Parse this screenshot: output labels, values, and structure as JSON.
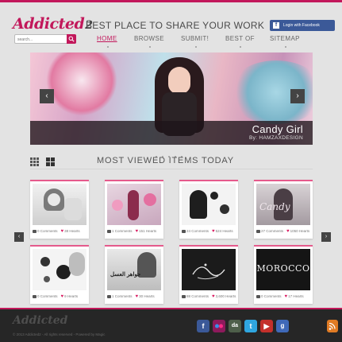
{
  "header": {
    "logo_text": "Addicted",
    "logo_number": "2",
    "tagline": "BEST PLACE TO SHARE YOUR WORK",
    "facebook_login": "Login with Facebook",
    "search_placeholder": "search..."
  },
  "nav": {
    "items": [
      {
        "label": "HOME",
        "active": true
      },
      {
        "label": "BROWSE"
      },
      {
        "label": "SUBMIT!"
      },
      {
        "label": "BEST OF"
      },
      {
        "label": "SITEMAP"
      }
    ]
  },
  "banner": {
    "title": "Candy Girl",
    "author": "By: HAMZAXDESIGN",
    "prev_icon": "chevron-left-icon",
    "next_icon": "chevron-right-icon"
  },
  "section": {
    "title": "MOST VIEWED ITEMS TODAY",
    "view_icons": [
      "list-grid-icon",
      "large-grid-icon"
    ]
  },
  "items": [
    {
      "comments": "0 Comments",
      "hearts": "38 Hearts"
    },
    {
      "comments": "1 Comments",
      "hearts": "151 Hearts"
    },
    {
      "comments": "24 Comments",
      "hearts": "524 Hearts"
    },
    {
      "comments": "27 Comments",
      "hearts": "1050 Hearts"
    },
    {
      "comments": "0 Comments",
      "hearts": "9 Hearts"
    },
    {
      "comments": "1 Comments",
      "hearts": "30 Hearts"
    },
    {
      "comments": "88 Comments",
      "hearts": "3,600 Hearts"
    },
    {
      "comments": "0 Comments",
      "hearts": "17 Hearts"
    }
  ],
  "item_thumb_text": {
    "card4": "Candy",
    "card6": "جواهر العسل",
    "card8": "MOROCCO"
  },
  "footer": {
    "logo_text": "Addicted",
    "copyright": "© 2013 Addicted2 - All rights reserved - Powered by Magic",
    "social": [
      "facebook-icon",
      "flickr-icon",
      "deviantart-icon",
      "twitter-icon",
      "youtube-icon",
      "google-plus-icon",
      "rss-icon"
    ]
  },
  "colors": {
    "accent": "#c2185b",
    "facebook": "#3b5998",
    "footer_bg": "#262626"
  }
}
